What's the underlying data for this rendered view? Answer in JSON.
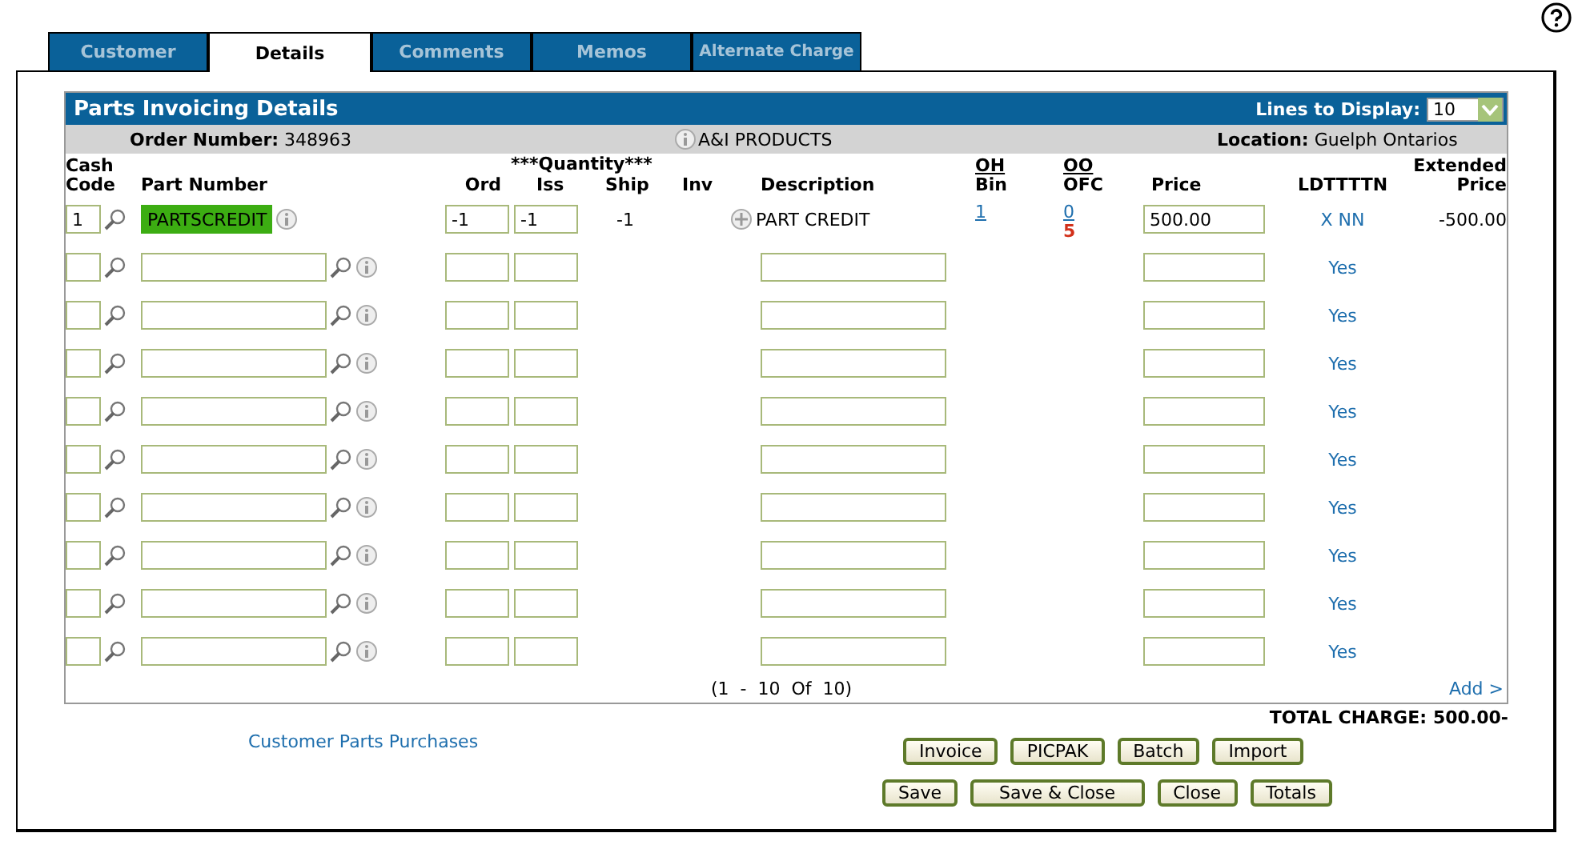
{
  "tabs": [
    {
      "label": "Customer",
      "selected": false
    },
    {
      "label": "Details",
      "selected": true
    },
    {
      "label": "Comments",
      "selected": false
    },
    {
      "label": "Memos",
      "selected": false
    },
    {
      "label": "Alternate Charge",
      "selected": false
    }
  ],
  "panel": {
    "title": "Parts Invoicing Details",
    "lines_label": "Lines to Display:",
    "lines_value": "10",
    "order_label": "Order Number:",
    "order_number": "348963",
    "vendor": "A&I PRODUCTS",
    "location_label": "Location:",
    "location": "Guelph Ontarios"
  },
  "columns": {
    "cash": "Cash",
    "code": "Code",
    "part": "Part Number",
    "quantity": "***Quantity***",
    "ord": "Ord",
    "iss": "Iss",
    "ship": "Ship",
    "inv": "Inv",
    "description": "Description",
    "oh": "OH",
    "bin": "Bin",
    "oo": "OO",
    "ofc": "OFC",
    "price": "Price",
    "ldt": "LDTTTTN",
    "extended": "Extended",
    "extended2": "Price"
  },
  "rows": [
    {
      "kind": "filled",
      "cash_code": "1",
      "part_number": "PARTSCREDIT",
      "highlighted": true,
      "ord": "-1",
      "iss": "-1",
      "ship": "-1",
      "description": "PART CREDIT",
      "oh_bin": "1",
      "oo": "0",
      "ofc": "5",
      "price": "500.00",
      "ldtttn": "X NN",
      "extended_price": "-500.00"
    },
    {
      "kind": "blank",
      "ldtttn": "Yes"
    },
    {
      "kind": "blank",
      "ldtttn": "Yes"
    },
    {
      "kind": "blank",
      "ldtttn": "Yes"
    },
    {
      "kind": "blank",
      "ldtttn": "Yes"
    },
    {
      "kind": "blank",
      "ldtttn": "Yes"
    },
    {
      "kind": "blank",
      "ldtttn": "Yes"
    },
    {
      "kind": "blank",
      "ldtttn": "Yes"
    },
    {
      "kind": "blank",
      "ldtttn": "Yes"
    },
    {
      "kind": "blank",
      "ldtttn": "Yes"
    }
  ],
  "pager": "(1  -  10  Of  10)",
  "add_link": "Add >",
  "total_label": "TOTAL CHARGE:",
  "total": "500.00-",
  "purchases_link": "Customer Parts Purchases",
  "buttons_row1": [
    "Invoice",
    "PICPAK",
    "Batch",
    "Import"
  ],
  "buttons_row2": [
    "Save",
    "Save & Close",
    "Close",
    "Totals"
  ]
}
